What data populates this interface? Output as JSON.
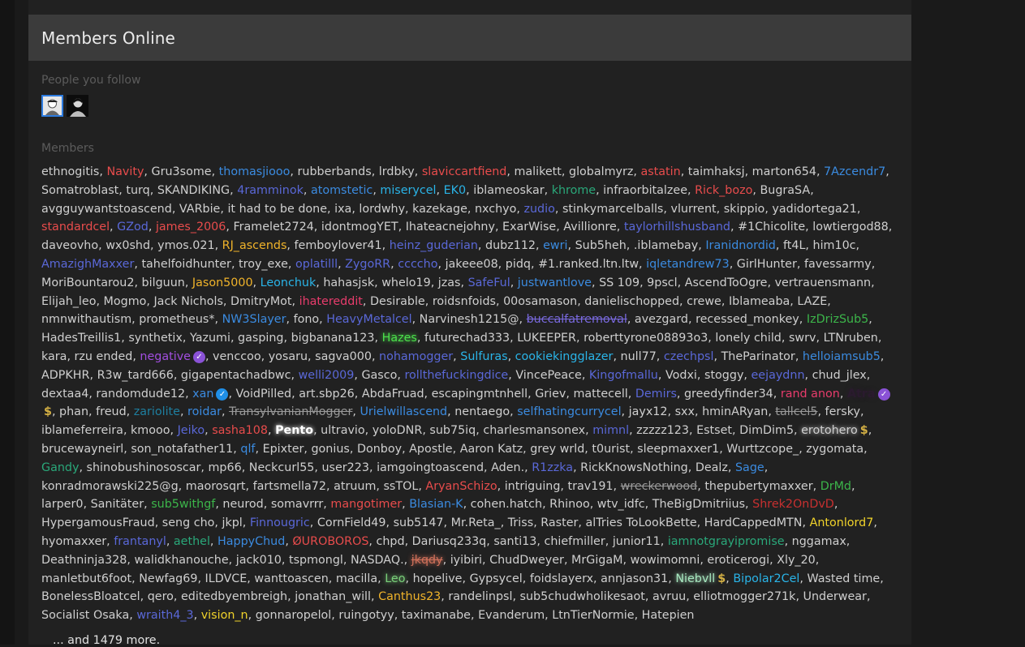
{
  "panel": {
    "title": "Members Online",
    "following_label": "People you follow",
    "members_label": "Members",
    "more_text": "... and 1479 more."
  },
  "following": [
    {
      "name": "follow-avatar-1",
      "highlight": true
    },
    {
      "name": "follow-avatar-2",
      "highlight": false
    }
  ],
  "members": [
    {
      "t": "ethnogitis"
    },
    {
      "t": "Navity",
      "c": "#e84c4c"
    },
    {
      "t": "Gru3some"
    },
    {
      "t": "thomasjiooo",
      "c": "#3b8be0"
    },
    {
      "t": "rubberbands"
    },
    {
      "t": "lrdbky"
    },
    {
      "t": "slaviccartfiend",
      "c": "#e84c4c"
    },
    {
      "t": "malikett"
    },
    {
      "t": "globalmyrz"
    },
    {
      "t": "astatin",
      "c": "#e84c4c"
    },
    {
      "t": "taimhaksj"
    },
    {
      "t": "marton654"
    },
    {
      "t": "7Azcendr7",
      "c": "#3b8be0"
    },
    {
      "t": "Somatroblast"
    },
    {
      "t": "turq"
    },
    {
      "t": "SKANDIKING"
    },
    {
      "t": "4ramminok",
      "c": "#5a68d8"
    },
    {
      "t": "atomstetic",
      "c": "#3b8be0"
    },
    {
      "t": "miserycel",
      "c": "#2ab4e8"
    },
    {
      "t": "EK0",
      "c": "#2ab4e8"
    },
    {
      "t": "iblameoskar"
    },
    {
      "t": "khrome",
      "c": "#2aa87a"
    },
    {
      "t": "infraorbitalzee"
    },
    {
      "t": "Rick_bozo",
      "c": "#e84c4c"
    },
    {
      "t": "BugraSA"
    },
    {
      "t": "avgguywantstoascend"
    },
    {
      "t": "VARbie"
    },
    {
      "t": "it had to be done"
    },
    {
      "t": "ixa"
    },
    {
      "t": "lordwhy"
    },
    {
      "t": "kazekage"
    },
    {
      "t": "nxchyo"
    },
    {
      "t": "zudio",
      "c": "#5a68d8"
    },
    {
      "t": "stinkymarcelballs"
    },
    {
      "t": "vlurrent"
    },
    {
      "t": "skippio"
    },
    {
      "t": "yadidortega21"
    },
    {
      "t": "standardcel",
      "c": "#e84c4c"
    },
    {
      "t": "GZod",
      "c": "#5a68d8"
    },
    {
      "t": "james_2006",
      "c": "#e84c4c"
    },
    {
      "t": "Framelet2724"
    },
    {
      "t": "idontmogYET"
    },
    {
      "t": "Ihateacnejohny"
    },
    {
      "t": "ExarWise"
    },
    {
      "t": "Avillionre"
    },
    {
      "t": "taylorhillshusband",
      "c": "#5a68d8"
    },
    {
      "t": "#1Chicolite"
    },
    {
      "t": "lowtiergod88"
    },
    {
      "t": "daveovho"
    },
    {
      "t": "wx0shd"
    },
    {
      "t": "ymos.021"
    },
    {
      "t": "RJ_ascends",
      "c": "#f0b32a"
    },
    {
      "t": "femboylover41"
    },
    {
      "t": "heinz_guderian",
      "c": "#5a68d8"
    },
    {
      "t": "dubz112"
    },
    {
      "t": "ewri",
      "c": "#3b8be0"
    },
    {
      "t": "Sub5heh"
    },
    {
      "t": ".iblamebay"
    },
    {
      "t": "Iranidnordid",
      "c": "#3b8be0"
    },
    {
      "t": "ft4L"
    },
    {
      "t": "him10c"
    },
    {
      "t": "AmazighMaxxer",
      "c": "#5a68d8"
    },
    {
      "t": "tahelfoidhunter"
    },
    {
      "t": "troy_exe"
    },
    {
      "t": "oplatilll",
      "c": "#5a68d8"
    },
    {
      "t": "ZygoRR",
      "c": "#5a68d8"
    },
    {
      "t": "ccccho",
      "c": "#5a68d8"
    },
    {
      "t": "jakeee08"
    },
    {
      "t": "pidq"
    },
    {
      "t": "#1.ranked.ltn.ltw"
    },
    {
      "t": "iqletandrew73",
      "c": "#3b8be0"
    },
    {
      "t": "GirlHunter"
    },
    {
      "t": "favessarmy"
    },
    {
      "t": "MoriBountarou2"
    },
    {
      "t": "bilguun"
    },
    {
      "t": "Jason5000",
      "c": "#f0b32a"
    },
    {
      "t": "Leonchuk",
      "c": "#2ab4e8"
    },
    {
      "t": "hahasjsk"
    },
    {
      "t": "whelo19"
    },
    {
      "t": "jzas"
    },
    {
      "t": "SafeFul",
      "c": "#5a68d8"
    },
    {
      "t": "justwantlove",
      "c": "#3b8be0"
    },
    {
      "t": "SS 109"
    },
    {
      "t": "9pscl"
    },
    {
      "t": "AscendToOgre"
    },
    {
      "t": "vertrauensmann"
    },
    {
      "t": "Elijah_leo"
    },
    {
      "t": "Mogmo"
    },
    {
      "t": "Jack Nichols"
    },
    {
      "t": "DmitryMot"
    },
    {
      "t": "ihatereddit",
      "c": "#e83c6c"
    },
    {
      "t": "Desirable"
    },
    {
      "t": "roidsnfoids"
    },
    {
      "t": "00osamason"
    },
    {
      "t": "danielischopped"
    },
    {
      "t": "crewe"
    },
    {
      "t": "Iblameaba"
    },
    {
      "t": "LAZE"
    },
    {
      "t": "nmnwithautism"
    },
    {
      "t": "prometheus*"
    },
    {
      "t": "NW3Slayer",
      "c": "#3b8be0"
    },
    {
      "t": "fono"
    },
    {
      "t": "HeavyMetalcel",
      "c": "#5a68d8"
    },
    {
      "t": "Narvinesh1215@"
    },
    {
      "t": "buccalfatremoval",
      "c": "#7a6ae0",
      "s": true
    },
    {
      "t": "avezgard"
    },
    {
      "t": "recessed_monkey"
    },
    {
      "t": "IzDrizSub5",
      "c": "#3cb54a"
    },
    {
      "t": "HadesTreillis1"
    },
    {
      "t": "synthetix"
    },
    {
      "t": "Yazumi"
    },
    {
      "t": "gasping"
    },
    {
      "t": "bigbanana123"
    },
    {
      "t": "Hazes",
      "c": "#4be04b",
      "g": true
    },
    {
      "t": "futurechad333"
    },
    {
      "t": "LUKEEPER"
    },
    {
      "t": "roberttyrone08893o3"
    },
    {
      "t": "lonely child"
    },
    {
      "t": "swrv"
    },
    {
      "t": "LTNruben"
    },
    {
      "t": "kara"
    },
    {
      "t": "rzu ended"
    },
    {
      "t": "negative",
      "c": "#a24ee0",
      "b": "purple"
    },
    {
      "t": "venccoo"
    },
    {
      "t": "yosaru"
    },
    {
      "t": "sagva000"
    },
    {
      "t": "nohamogger",
      "c": "#5a68d8"
    },
    {
      "t": "Sulfuras",
      "c": "#2ab4e8"
    },
    {
      "t": "cookiekingglazer",
      "c": "#2ab4e8"
    },
    {
      "t": "null77"
    },
    {
      "t": "czechpsl",
      "c": "#5a68d8"
    },
    {
      "t": "TheParinator"
    },
    {
      "t": "helloiamsub5",
      "c": "#3b8be0"
    },
    {
      "t": "ADPKHR"
    },
    {
      "t": "R3w_tard666"
    },
    {
      "t": "gigapentachadbwc"
    },
    {
      "t": "welli2009",
      "c": "#5a68d8"
    },
    {
      "t": "Gasco"
    },
    {
      "t": "rollthefuckingdice",
      "c": "#5a68d8"
    },
    {
      "t": "VincePeace"
    },
    {
      "t": "Kingofmallu",
      "c": "#5a68d8"
    },
    {
      "t": "Vodxi"
    },
    {
      "t": "stoggy"
    },
    {
      "t": "eejaydnn",
      "c": "#5a68d8"
    },
    {
      "t": "chud_jlex"
    },
    {
      "t": "dextaa4"
    },
    {
      "t": "randomdude12"
    },
    {
      "t": "xan",
      "c": "#3b8be0",
      "b": "blue"
    },
    {
      "t": "VoidPilled"
    },
    {
      "t": "art.sbp26"
    },
    {
      "t": "AbdaFruad"
    },
    {
      "t": "escapingmtnhell"
    },
    {
      "t": "Griev"
    },
    {
      "t": "mattecell"
    },
    {
      "t": "Demirs",
      "c": "#5a68d8"
    },
    {
      "t": "greedyfinder34"
    },
    {
      "t": "rand anon",
      "c": "#e83c6c"
    },
    {
      "t": "Atra",
      "c": "#2a1a2e",
      "bold": true,
      "g": true,
      "b": "purple",
      "d": true
    },
    {
      "t": "phan"
    },
    {
      "t": "freud"
    },
    {
      "t": "zariolite",
      "c": "#1e7fa0"
    },
    {
      "t": "roidar",
      "c": "#3b8be0"
    },
    {
      "t": "TransylvanianMogger",
      "s": true
    },
    {
      "t": "Urielwillascend",
      "c": "#3b8be0"
    },
    {
      "t": "nentaego"
    },
    {
      "t": "selfhatingcurrycel",
      "c": "#3b8be0"
    },
    {
      "t": "jayx12"
    },
    {
      "t": "sxx"
    },
    {
      "t": "hminARyan"
    },
    {
      "t": "tallcel5",
      "s": true
    },
    {
      "t": "fersky"
    },
    {
      "t": "iblameferreira"
    },
    {
      "t": "kmooo"
    },
    {
      "t": "Jeiko",
      "c": "#5a68d8"
    },
    {
      "t": "sasha108",
      "c": "#e84c4c"
    },
    {
      "t": "Pento",
      "c": "#ffffff",
      "bold": true,
      "g": true
    },
    {
      "t": "ultravio"
    },
    {
      "t": "yoloDNR"
    },
    {
      "t": "sub75iq"
    },
    {
      "t": "charlesmansonex"
    },
    {
      "t": "mimnl",
      "c": "#5a68d8"
    },
    {
      "t": "zzzzz123"
    },
    {
      "t": "Estset"
    },
    {
      "t": "DimDim5"
    },
    {
      "t": "erotohero",
      "c": "#cfcfcf",
      "g": true,
      "d": true
    },
    {
      "t": "brucewayneirl"
    },
    {
      "t": "son_notafather11"
    },
    {
      "t": "qlf",
      "c": "#3b8be0"
    },
    {
      "t": "Epixter"
    },
    {
      "t": "gonius"
    },
    {
      "t": "Donboy"
    },
    {
      "t": "Apostle"
    },
    {
      "t": "Aaron Katz"
    },
    {
      "t": "grey wrld"
    },
    {
      "t": "t0urist"
    },
    {
      "t": "sleepmaxxer1"
    },
    {
      "t": "Wurttzcope_"
    },
    {
      "t": "zygomata"
    },
    {
      "t": "Gandy",
      "c": "#2aa87a"
    },
    {
      "t": "shinobushinososcar"
    },
    {
      "t": "mp66"
    },
    {
      "t": "Neckcurl55"
    },
    {
      "t": "user223"
    },
    {
      "t": "iamgoingtoascend"
    },
    {
      "t": "Aden."
    },
    {
      "t": "R1zzka",
      "c": "#5a68d8"
    },
    {
      "t": "RickKnowsNothing"
    },
    {
      "t": "Dealz"
    },
    {
      "t": "Sage",
      "c": "#3b8be0"
    },
    {
      "t": "konradmorawski225@g"
    },
    {
      "t": "maorosqrt"
    },
    {
      "t": "fartsmella72"
    },
    {
      "t": "atruum"
    },
    {
      "t": "ssTOL"
    },
    {
      "t": "AryanSchizo",
      "c": "#e84c4c"
    },
    {
      "t": "intriguing"
    },
    {
      "t": "trav191"
    },
    {
      "t": "wreckerwood",
      "s": true
    },
    {
      "t": "thepubertymaxxer"
    },
    {
      "t": "DrMd",
      "c": "#3cb54a"
    },
    {
      "t": "larper0"
    },
    {
      "t": "Sanitäter"
    },
    {
      "t": "sub5withgf",
      "c": "#3cb54a"
    },
    {
      "t": "neurod"
    },
    {
      "t": "somavrrr"
    },
    {
      "t": "mangotimer",
      "c": "#e84c4c"
    },
    {
      "t": "Blasian-K",
      "c": "#3b8be0"
    },
    {
      "t": "cohen.hatch"
    },
    {
      "t": "Rhinoo"
    },
    {
      "t": "wtv_idfc"
    },
    {
      "t": "TheBigDmitriius"
    },
    {
      "t": "Shrek2OnDvD",
      "c": "#c83030"
    },
    {
      "t": "HypergamousFraud"
    },
    {
      "t": "seng cho"
    },
    {
      "t": "jkpl"
    },
    {
      "t": "Finnougric",
      "c": "#5a68d8"
    },
    {
      "t": "CornField49"
    },
    {
      "t": "sub5147"
    },
    {
      "t": "Mr.Reta_"
    },
    {
      "t": "Triss"
    },
    {
      "t": "Raster"
    },
    {
      "t": "alTries ToLookBette"
    },
    {
      "t": "HardCappedMTN"
    },
    {
      "t": "Antonlord7",
      "c": "#f0d22a"
    },
    {
      "t": "hyomaxxer"
    },
    {
      "t": "frantanyl",
      "c": "#5a68d8"
    },
    {
      "t": "aethel",
      "c": "#2aa87a"
    },
    {
      "t": "HappyChud",
      "c": "#3b8be0"
    },
    {
      "t": "ØUROBOROS",
      "c": "#e84c4c"
    },
    {
      "t": "chpd"
    },
    {
      "t": "Dariusq233q"
    },
    {
      "t": "santi13"
    },
    {
      "t": "chiefmiller"
    },
    {
      "t": "junior11"
    },
    {
      "t": "iamnotgrayipromise",
      "c": "#2aa87a"
    },
    {
      "t": "nggamax"
    },
    {
      "t": "Deathninja328"
    },
    {
      "t": "walidkhanouche"
    },
    {
      "t": "jack010"
    },
    {
      "t": "tspmongl"
    },
    {
      "t": "NASDAQ."
    },
    {
      "t": "jkqdy",
      "c": "#d0705a",
      "s": true,
      "g": true
    },
    {
      "t": "iyibiri"
    },
    {
      "t": "ChudDweyer"
    },
    {
      "t": "MrGigaM"
    },
    {
      "t": "wowimomni"
    },
    {
      "t": "eroticerogi"
    },
    {
      "t": "Xly_20"
    },
    {
      "t": "manletbut6foot"
    },
    {
      "t": "Newfag69"
    },
    {
      "t": "ILDVCE"
    },
    {
      "t": "wanttoascen"
    },
    {
      "t": "macilla"
    },
    {
      "t": "Leo",
      "c": "#7ad07a",
      "g": true
    },
    {
      "t": "hopelive"
    },
    {
      "t": "Gypsycel"
    },
    {
      "t": "foidslayerx"
    },
    {
      "t": "annjason31"
    },
    {
      "t": "Niebvll",
      "c": "#a8e8c0",
      "g": true,
      "d": true
    },
    {
      "t": "Bipolar2Cel",
      "c": "#2ab4e8"
    },
    {
      "t": "Wasted time"
    },
    {
      "t": "BonelessBloatcel"
    },
    {
      "t": "qero"
    },
    {
      "t": "editedbyembreigh"
    },
    {
      "t": "jonathan_will"
    },
    {
      "t": "Canthus23",
      "c": "#f0b32a"
    },
    {
      "t": "randelinpsl"
    },
    {
      "t": "sub5chudwholikesaot"
    },
    {
      "t": "avruu"
    },
    {
      "t": "elliotmogger271k"
    },
    {
      "t": "Underwear"
    },
    {
      "t": "Socialist Osaka"
    },
    {
      "t": "wraith4_3",
      "c": "#5a68d8"
    },
    {
      "t": "vision_n",
      "c": "#f0d22a"
    },
    {
      "t": "gonnaropelol"
    },
    {
      "t": "ruingotyy"
    },
    {
      "t": "taximanabe"
    },
    {
      "t": "Evanderum"
    },
    {
      "t": "LtnTierNormie"
    },
    {
      "t": "Hatepien",
      "last": true
    }
  ]
}
